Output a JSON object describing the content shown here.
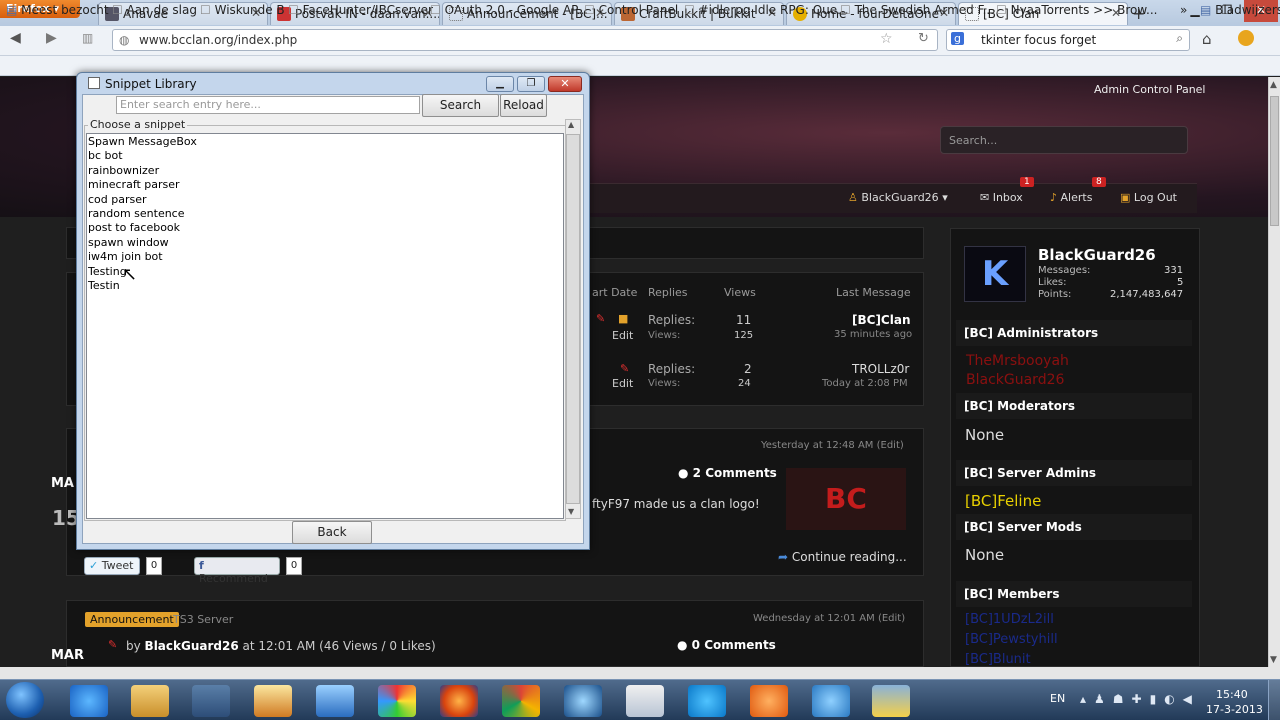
{
  "browser": {
    "menu_label": "Firefox",
    "tabs": [
      {
        "label": "Anavae"
      },
      {
        "label": "Postvak IN - daan.van...."
      },
      {
        "label": "Announcement - [BC]..."
      },
      {
        "label": "CraftBukkit | Bukkit"
      },
      {
        "label": "Home - fourDeltaOne"
      },
      {
        "label": "[BC] Clan"
      }
    ],
    "new_tab": "+",
    "url": "www.bcclan.org/index.php",
    "search_value": "tkinter focus forget",
    "bookmarks": [
      {
        "label": "Meest bezocht"
      },
      {
        "label": "Aan de slag"
      },
      {
        "label": "Wiskunde B"
      },
      {
        "label": "FaceHunter/IBCserver"
      },
      {
        "label": "OAuth 2.0 - Google AP..."
      },
      {
        "label": "Control Panel"
      },
      {
        "label": "#idlerpg Idle RPG: Que..."
      },
      {
        "label": "The Swedish Armed F..."
      },
      {
        "label": "NyaaTorrents >> Brow..."
      },
      {
        "label": "Bladwijzers"
      }
    ],
    "bookmarks_overflow": "»"
  },
  "site": {
    "admin_link": "Admin Control Panel",
    "search_placeholder": "Search...",
    "user": "BlackGuard26",
    "inbox": "Inbox",
    "inbox_count": "1",
    "alerts": "Alerts",
    "alerts_count": "8",
    "logout": "Log Out",
    "thread_headers": {
      "start_date": "art Date",
      "replies": "Replies",
      "views": "Views",
      "last_message": "Last Message"
    },
    "threads": [
      {
        "edit": "Edit",
        "replies_label": "Replies:",
        "replies": "11",
        "views_label": "Views:",
        "views": "125",
        "last_user": "[BC]Clan",
        "last_time": "35 minutes ago"
      },
      {
        "edit": "Edit",
        "replies_label": "Replies:",
        "replies": "2",
        "views_label": "Views:",
        "views": "24",
        "last_user": "TROLLz0r",
        "last_time": "Today at 2:08 PM"
      }
    ],
    "post1": {
      "meta": "Yesterday at 12:48 AM (Edit)",
      "comments": "2 Comments",
      "text": "ftyF97 made us a clan logo!",
      "continue": "Continue reading...",
      "logo_text": "BC",
      "date_month": "MA",
      "date_day": "15"
    },
    "social": {
      "tweet": "Tweet",
      "tweet_count": "0",
      "recommend": "Recommend",
      "recommend_count": "0"
    },
    "post2": {
      "tag": "Announcement",
      "title": "TS3 Server",
      "meta": "Wednesday at 12:01 AM (Edit)",
      "by_prefix": "by",
      "author": "BlackGuard26",
      "details": "at 12:01 AM (46 Views / 0 Likes)",
      "comments": "0 Comments",
      "date_month": "MAR"
    },
    "profile": {
      "name": "BlackGuard26",
      "messages_label": "Messages:",
      "messages": "331",
      "likes_label": "Likes:",
      "likes": "5",
      "points_label": "Points:",
      "points": "2,147,483,647"
    },
    "groups": [
      {
        "title": "[BC] Administrators",
        "members": [
          "TheMrsbooyah",
          "BlackGuard26"
        ],
        "color": "#8b1010"
      },
      {
        "title": "[BC] Moderators",
        "members": [
          "None"
        ],
        "color": "#dddddd"
      },
      {
        "title": "[BC] Server Admins",
        "members": [
          "[BC]Feline"
        ],
        "color": "#e8d000"
      },
      {
        "title": "[BC] Server Mods",
        "members": [
          "None"
        ],
        "color": "#dddddd"
      },
      {
        "title": "[BC] Members",
        "members": [
          "[BC]1UDzL2ill",
          "[BC]Pewstyhill",
          "[BC]Blunit"
        ],
        "color": "#1a2a8a"
      }
    ]
  },
  "dialog": {
    "title": "Snippet Library",
    "search_placeholder": "Enter search entry here...",
    "search_button": "Search",
    "reload_button": "Reload",
    "group_label": "Choose a snippet",
    "snippets": [
      "Spawn MessageBox",
      "bc bot",
      "rainbownizer",
      "minecraft parser",
      "cod parser",
      "random sentence",
      "post to facebook",
      "spawn window",
      "iw4m join bot",
      "Testing",
      "Testin"
    ],
    "back_button": "Back"
  },
  "taskbar": {
    "lang": "EN",
    "time": "15:40",
    "date": "17-3-2013"
  }
}
